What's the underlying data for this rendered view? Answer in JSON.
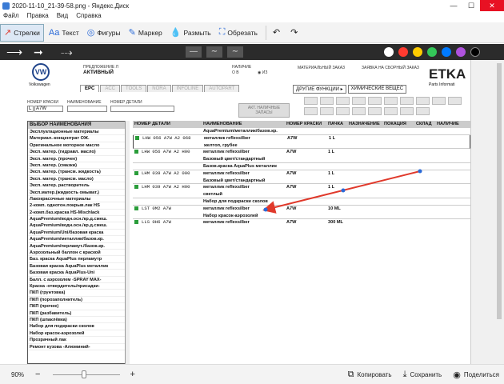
{
  "window": {
    "title": "2020-11-10_21-39-58.png - Яндекс.Диск",
    "minimize": "—",
    "maximize": "☐",
    "close": "✕"
  },
  "menu": [
    "Файл",
    "Правка",
    "Вид",
    "Справка"
  ],
  "toolbar": {
    "arrows": "Стрелки",
    "text": "Текст",
    "shapes": "Фигуры",
    "marker": "Маркер",
    "blur": "Размыть",
    "crop": "Обрезать",
    "undo_icon": "undo-icon",
    "redo_icon": "redo-icon"
  },
  "colors": {
    "accent_arrow": "#e0392b",
    "swatches": [
      "#ffffff",
      "#ff3b30",
      "#ffcc00",
      "#34c759",
      "#007aff",
      "#af52de",
      "#000000"
    ]
  },
  "etka": {
    "brand": "Volkswagen",
    "vw_logo": "VW",
    "pred_label": "ПРЕДЛОЖЕНИЕ Л",
    "pred_value": "АКТИВНЫЙ",
    "presence_label": "НАЛИЧИЕ",
    "presence_o": "О В",
    "presence_iz": "◉ ИЗ",
    "material_order": "МАТЕРИАЛЬНЫЙ ЗАКАЗ",
    "warehouse_order": "ЗАЯВКА НА СБОРНЫЙ ЗАКАЗ",
    "logo": "ETKA",
    "logo_sub": "Parts Informati",
    "tabs": [
      "EPC",
      "ACC",
      "TOOLS",
      "NORA",
      "INFOLINE",
      "AUTOPART"
    ],
    "other_functions": "ДРУГИЕ ФУНКЦИИ ▸",
    "chem_dropdown": "ХИМИЧЕСКИЕ ВЕЩЕС",
    "paint_number_label": "НОМЕР КРАСКИ",
    "paint_prefix": "L",
    "paint_value": "A7W",
    "name_label": "НАИМЕНОВАНИЕ",
    "part_number_label": "НОМЕР ДЕТАЛИ",
    "btn_stock": "АКТ. НАЛИЧНЫЕ ЗАПАСЫ",
    "left_header": "ВЫБОР НАИМЕНОВАНИЯ",
    "left_items": [
      "Эксплуатационные материалы",
      "Материал.-концентрат ОЖ.",
      "Оригинальное моторное масло",
      "Эксп. матер. (гидравл. масло)",
      "Эксп. матер. (прочее)",
      "Эксп. матер. (смазки)",
      "Эксп. матер. (трансм. жидкость)",
      "Эксп. матер. (трансм. масло)",
      "Эксп. матер. растворитель",
      "Эксп.матер.(жидкость омыват.)",
      "Лакокрасочные материалы",
      "2-комп. однотон.покрыв.лак HS",
      "2-комп.баз.краска HS-Mischlack",
      "AquaPremium/водн.осн./кр.д.смеш.",
      "AquaPremium/водн.осн./кр.д.смеш.",
      "AquaPremium/Uni/базовая краска",
      "AquaPremium/металлик/базов.кр.",
      "AquaPremium/перламут./базов.кр.",
      "Аэрозольный баллон с краской",
      "Баз. краска AquaPlus перламутр",
      "Базовая краска AquaPlus металлик",
      "Базовая краска AquaPlus-Uni",
      "Балл. с аэрозолем -SPRAY MAX-",
      "Краска -отвердитель/присадки-",
      "ПКП (грунтовка)",
      "ПКП (порозаполнитель)",
      "ПКП (прочее)",
      "ПКП (разбавитель)",
      "ПКП (шпаклёвка)",
      "Набор для подкраски сколов",
      "Набор красок-аэрозолей",
      "Прозрачный лак",
      "Ремонт кузова -Алюминий-"
    ],
    "columns": [
      "НОМЕР ДЕТАЛИ",
      "НАИМЕНОВАНИЕ",
      "НОМЕР КРАСКИ",
      "ПАЧКА",
      "НАЗНАЧЕНИЕ",
      "ПОКАЦИЯ",
      "СКЛАД",
      "НАЛИЧИЕ"
    ],
    "rows": [
      {
        "pn": "",
        "name": "AquaPremium/металлик/базов.кр.",
        "paint": "",
        "qty": "",
        "box": false
      },
      {
        "pn": "LHW 056 A7W A2 068",
        "name": "металлик reflexsilber",
        "paint": "A7W",
        "qty": "1 L",
        "box": true
      },
      {
        "pn": "",
        "name": "желтоп, грубее",
        "paint": "",
        "qty": "",
        "box": true
      },
      {
        "pn": "LHW 056 A7W A2 H00",
        "name": "металлик reflexsilber",
        "paint": "A7W",
        "qty": "1 L",
        "box": false
      },
      {
        "pn": "",
        "name": "Базовый цвет/стандартный",
        "paint": "",
        "qty": "",
        "box": false
      },
      {
        "pn": "",
        "name": "Базов.краска AquaPlus металлик",
        "paint": "",
        "qty": "",
        "box": false
      },
      {
        "pn": "LHM 039 A7W A2 000",
        "name": "металлик reflexsilber",
        "paint": "A7W",
        "qty": "1 L",
        "box": false
      },
      {
        "pn": "",
        "name": "Базовый цвет/стандартный",
        "paint": "",
        "qty": "",
        "box": false
      },
      {
        "pn": "LHM 039 A7W A2 H00",
        "name": "металлик reflexsilber",
        "paint": "A7W",
        "qty": "1 L",
        "box": false
      },
      {
        "pn": "",
        "name": "светлый",
        "paint": "",
        "qty": "",
        "box": false
      },
      {
        "pn": "",
        "name": "Набор для подкраски сколов",
        "paint": "",
        "qty": "",
        "box": false
      },
      {
        "pn": "LST 0M2 A7W",
        "name": "металлик reflexsilber",
        "paint": "A7W",
        "qty": "10 ML",
        "box": false
      },
      {
        "pn": "",
        "name": "Набор красок-аэрозолей",
        "paint": "",
        "qty": "",
        "box": false
      },
      {
        "pn": "LLS 0H6 A7W",
        "name": "металлик reflexsilber",
        "paint": "A7W",
        "qty": "300 ML",
        "box": false
      }
    ]
  },
  "bottom": {
    "zoom": "90%",
    "zoom_out": "−",
    "zoom_in": "+",
    "copy": "Копировать",
    "save": "Сохранить",
    "share": "Поделиться"
  }
}
